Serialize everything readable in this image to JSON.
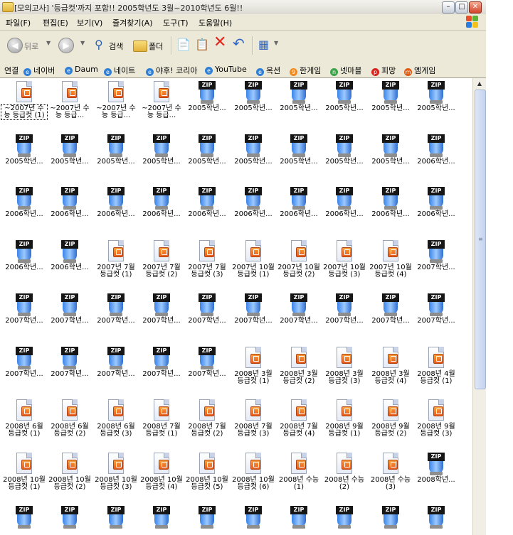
{
  "window": {
    "title": "[모의고사] '등급컷'까지 포함!! 2005학년도 3월~2010학년도 6월!!"
  },
  "titlebar_buttons": {
    "minimize": "–",
    "maximize": "□",
    "close": "✕"
  },
  "menu": [
    "파일(F)",
    "편집(E)",
    "보기(V)",
    "즐겨찾기(A)",
    "도구(T)",
    "도움말(H)"
  ],
  "toolbar": {
    "back_label": "뒤로",
    "search_label": "검색",
    "folders_label": "폴더"
  },
  "links": {
    "label": "연결",
    "items": [
      "네이버",
      "Daum",
      "네이트",
      "야후! 코리아",
      "YouTube",
      "옥션",
      "한게임",
      "넷마블",
      "피망",
      "엠게임"
    ]
  },
  "files": [
    {
      "name": "~2007년 수능 등급컷 (1)",
      "type": "hwp"
    },
    {
      "name": "~2007년 수능 등급...",
      "type": "hwp"
    },
    {
      "name": "~2007년 수능 등급...",
      "type": "hwp"
    },
    {
      "name": "~2007년 수능 등급...",
      "type": "hwp"
    },
    {
      "name": "2005학년...",
      "type": "zip"
    },
    {
      "name": "2005학년...",
      "type": "zip"
    },
    {
      "name": "2005학년...",
      "type": "zip"
    },
    {
      "name": "2005학년...",
      "type": "zip"
    },
    {
      "name": "2005학년...",
      "type": "zip"
    },
    {
      "name": "2005학년...",
      "type": "zip"
    },
    {
      "name": "2005학년...",
      "type": "zip"
    },
    {
      "name": "2005학년...",
      "type": "zip"
    },
    {
      "name": "2005학년...",
      "type": "zip"
    },
    {
      "name": "2005학년...",
      "type": "zip"
    },
    {
      "name": "2005학년...",
      "type": "zip"
    },
    {
      "name": "2005학년...",
      "type": "zip"
    },
    {
      "name": "2005학년...",
      "type": "zip"
    },
    {
      "name": "2005학년...",
      "type": "zip"
    },
    {
      "name": "2005학년...",
      "type": "zip"
    },
    {
      "name": "2006학년...",
      "type": "zip"
    },
    {
      "name": "2006학년...",
      "type": "zip"
    },
    {
      "name": "2006학년...",
      "type": "zip"
    },
    {
      "name": "2006학년...",
      "type": "zip"
    },
    {
      "name": "2006학년...",
      "type": "zip"
    },
    {
      "name": "2006학년...",
      "type": "zip"
    },
    {
      "name": "2006학년...",
      "type": "zip"
    },
    {
      "name": "2006학년...",
      "type": "zip"
    },
    {
      "name": "2006학년...",
      "type": "zip"
    },
    {
      "name": "2006학년...",
      "type": "zip"
    },
    {
      "name": "2006학년...",
      "type": "zip"
    },
    {
      "name": "2006학년...",
      "type": "zip"
    },
    {
      "name": "2006학년...",
      "type": "zip"
    },
    {
      "name": "2007년 7월 등급컷 (1)",
      "type": "hwp"
    },
    {
      "name": "2007년 7월 등급컷 (2)",
      "type": "hwp"
    },
    {
      "name": "2007년 7월 등급컷 (3)",
      "type": "hwp"
    },
    {
      "name": "2007년 10월 등급컷 (1)",
      "type": "hwp"
    },
    {
      "name": "2007년 10월 등급컷 (2)",
      "type": "hwp"
    },
    {
      "name": "2007년 10월 등급컷 (3)",
      "type": "hwp"
    },
    {
      "name": "2007년 10월 등급컷 (4)",
      "type": "hwp"
    },
    {
      "name": "2007학년...",
      "type": "zip"
    },
    {
      "name": "2007학년...",
      "type": "zip"
    },
    {
      "name": "2007학년...",
      "type": "zip"
    },
    {
      "name": "2007학년...",
      "type": "zip"
    },
    {
      "name": "2007학년...",
      "type": "zip"
    },
    {
      "name": "2007학년...",
      "type": "zip"
    },
    {
      "name": "2007학년...",
      "type": "zip"
    },
    {
      "name": "2007학년...",
      "type": "zip"
    },
    {
      "name": "2007학년...",
      "type": "zip"
    },
    {
      "name": "2007학년...",
      "type": "zip"
    },
    {
      "name": "2007학년...",
      "type": "zip"
    },
    {
      "name": "2007학년...",
      "type": "zip"
    },
    {
      "name": "2007학년...",
      "type": "zip"
    },
    {
      "name": "2007학년...",
      "type": "zip"
    },
    {
      "name": "2007학년...",
      "type": "zip"
    },
    {
      "name": "2007학년...",
      "type": "zip"
    },
    {
      "name": "2008년 3월 등급컷 (1)",
      "type": "hwp"
    },
    {
      "name": "2008년 3월 등급컷 (2)",
      "type": "hwp"
    },
    {
      "name": "2008년 3월 등급컷 (3)",
      "type": "hwp"
    },
    {
      "name": "2008년 3월 등급컷 (4)",
      "type": "hwp"
    },
    {
      "name": "2008년 4월 등급컷 (1)",
      "type": "hwp"
    },
    {
      "name": "2008년 6월 등급컷 (1)",
      "type": "hwp"
    },
    {
      "name": "2008년 6월 등급컷 (2)",
      "type": "hwp"
    },
    {
      "name": "2008년 6월 등급컷 (3)",
      "type": "hwp"
    },
    {
      "name": "2008년 7월 등급컷 (1)",
      "type": "hwp"
    },
    {
      "name": "2008년 7월 등급컷 (2)",
      "type": "hwp"
    },
    {
      "name": "2008년 7월 등급컷 (3)",
      "type": "hwp"
    },
    {
      "name": "2008년 7월 등급컷 (4)",
      "type": "hwp"
    },
    {
      "name": "2008년 9월 등급컷 (1)",
      "type": "hwp"
    },
    {
      "name": "2008년 9월 등급컷 (2)",
      "type": "hwp"
    },
    {
      "name": "2008년 9월 등급컷 (3)",
      "type": "hwp"
    },
    {
      "name": "2008년 10월 등급컷 (1)",
      "type": "hwp"
    },
    {
      "name": "2008년 10월 등급컷 (2)",
      "type": "hwp"
    },
    {
      "name": "2008년 10월 등급컷 (3)",
      "type": "hwp"
    },
    {
      "name": "2008년 10월 등급컷 (4)",
      "type": "hwp"
    },
    {
      "name": "2008년 10월 등급컷 (5)",
      "type": "hwp"
    },
    {
      "name": "2008년 10월 등급컷 (6)",
      "type": "hwp"
    },
    {
      "name": "2008년 수능 (1)",
      "type": "hwp"
    },
    {
      "name": "2008년 수능 (2)",
      "type": "hwp"
    },
    {
      "name": "2008년 수능 (3)",
      "type": "hwp"
    },
    {
      "name": "2008학년...",
      "type": "zip"
    },
    {
      "name": "",
      "type": "zip"
    },
    {
      "name": "",
      "type": "zip"
    },
    {
      "name": "",
      "type": "zip"
    },
    {
      "name": "",
      "type": "zip"
    },
    {
      "name": "",
      "type": "zip"
    },
    {
      "name": "",
      "type": "zip"
    },
    {
      "name": "",
      "type": "zip"
    },
    {
      "name": "",
      "type": "zip"
    },
    {
      "name": "",
      "type": "zip"
    },
    {
      "name": "",
      "type": "zip"
    }
  ],
  "icons": {
    "zip_text": "ZIP"
  }
}
